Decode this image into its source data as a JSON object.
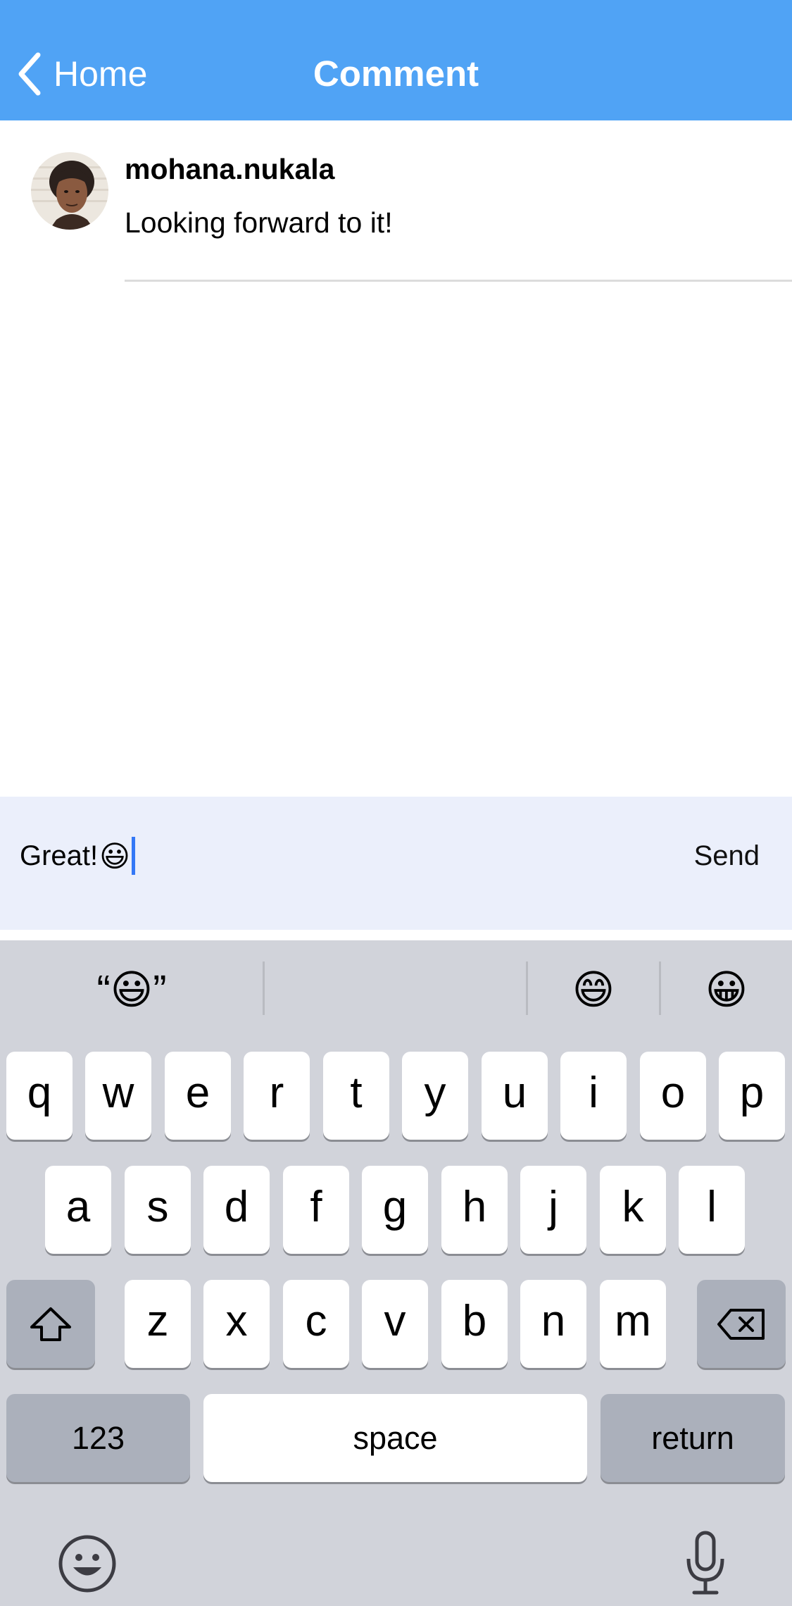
{
  "header": {
    "back_label": "Home",
    "title": "Comment",
    "background_color": "#50a3f5"
  },
  "comment": {
    "username": "mohana.nukala",
    "text": "Looking forward to it!"
  },
  "input": {
    "value": "Great!",
    "emoji": "😃",
    "send_label": "Send"
  },
  "keyboard": {
    "suggestions": [
      "“😃”",
      "",
      "😄",
      "😀"
    ],
    "row1": [
      "q",
      "w",
      "e",
      "r",
      "t",
      "y",
      "u",
      "i",
      "o",
      "p"
    ],
    "row2": [
      "a",
      "s",
      "d",
      "f",
      "g",
      "h",
      "j",
      "k",
      "l"
    ],
    "row3": [
      "z",
      "x",
      "c",
      "v",
      "b",
      "n",
      "m"
    ],
    "numbers_label": "123",
    "space_label": "space",
    "return_label": "return",
    "icons": [
      "shift-icon",
      "backspace-icon",
      "emoji-icon",
      "microphone-icon"
    ]
  }
}
